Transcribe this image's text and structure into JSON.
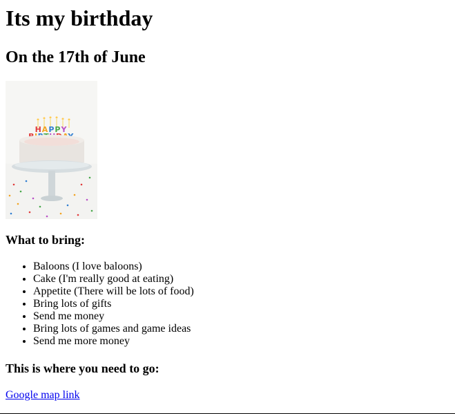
{
  "header": {
    "title": "Its my birthday",
    "date_line": "On the 17th of June"
  },
  "image": {
    "alt": "Birthday cake with HAPPY BIRTHDAY candles",
    "candle_text_top": "HAPPY",
    "candle_text_bottom": "BIRTHDAY",
    "colors": {
      "background": "#f3f3f1",
      "frosting": "#e8e4e0",
      "plate": "#d6dde0",
      "letters": [
        "#e03a3a",
        "#f2a321",
        "#2e7dd1",
        "#47a84a",
        "#b94fc6"
      ]
    }
  },
  "bring": {
    "heading": "What to bring:",
    "items": [
      "Baloons (I love baloons)",
      "Cake (I'm really good at eating)",
      "Appetite (There will be lots of food)",
      "Bring lots of gifts",
      "Send me money",
      "Bring lots of games and game ideas",
      "Send me more money"
    ]
  },
  "location": {
    "heading": "This is where you need to go:",
    "link_label": "Google map link"
  },
  "colors": {
    "link": "#0000ee",
    "text": "#000000"
  }
}
